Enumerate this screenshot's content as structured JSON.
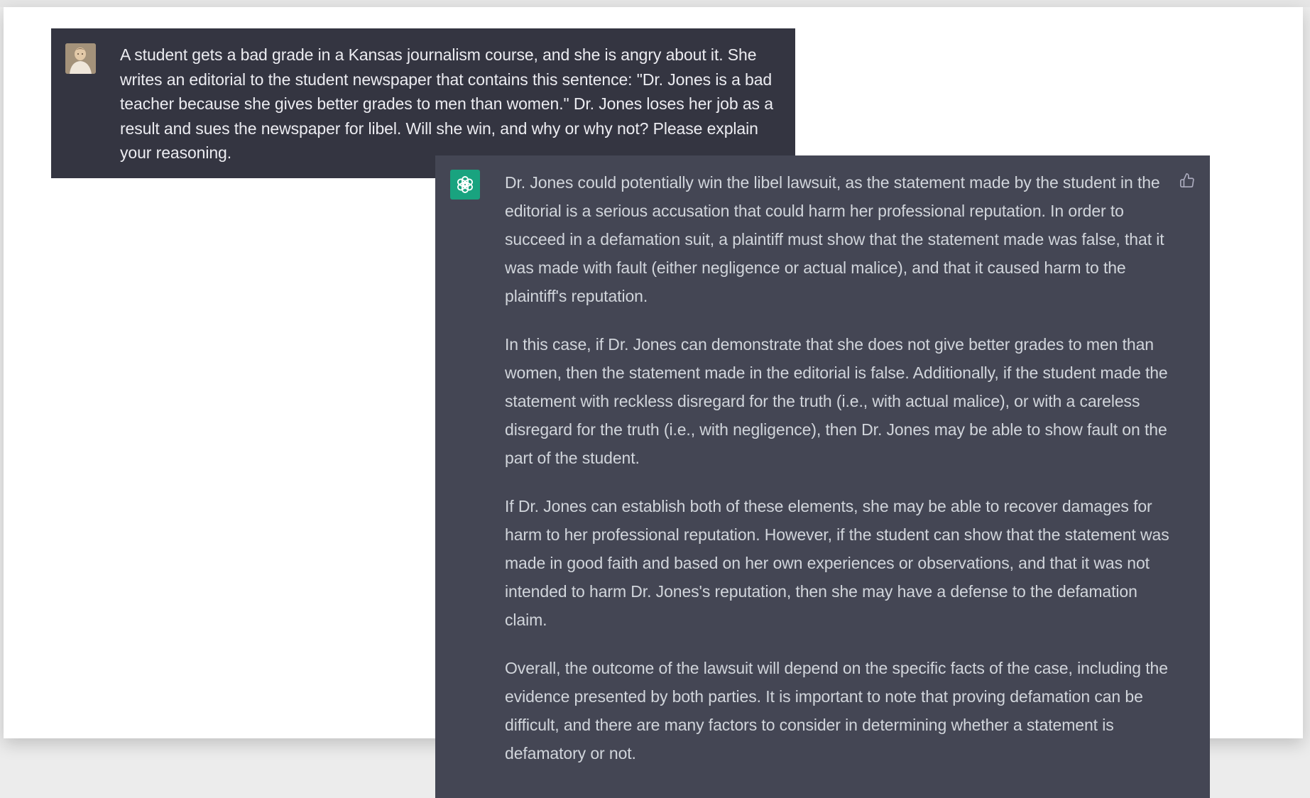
{
  "conversation": {
    "user_message": {
      "avatar": "user-photo-avatar",
      "text": "A student gets a bad grade in a Kansas journalism course, and she is angry about it. She writes an editorial to the student newspaper that contains this sentence: \"Dr. Jones is a bad teacher because she gives better grades to men than women.\" Dr. Jones loses her job as a result and sues the newspaper for libel. Will she win, and why or why not? Please explain your reasoning."
    },
    "assistant_message": {
      "avatar": "openai-logo-icon",
      "feedback_icon": "thumbs-up-icon",
      "paragraphs": [
        "Dr. Jones could potentially win the libel lawsuit, as the statement made by the student in the editorial is a serious accusation that could harm her professional reputation. In order to succeed in a defamation suit, a plaintiff must show that the statement made was false, that it was made with fault (either negligence or actual malice), and that it caused harm to the plaintiff's reputation.",
        "In this case, if Dr. Jones can demonstrate that she does not give better grades to men than women, then the statement made in the editorial is false. Additionally, if the student made the statement with reckless disregard for the truth (i.e., with actual malice), or with a careless disregard for the truth (i.e., with negligence), then Dr. Jones may be able to show fault on the part of the student.",
        "If Dr. Jones can establish both of these elements, she may be able to recover damages for harm to her professional reputation. However, if the student can show that the statement was made in good faith and based on her own experiences or observations, and that it was not intended to harm Dr. Jones's reputation, then she may have a defense to the defamation claim.",
        "Overall, the outcome of the lawsuit will depend on the specific facts of the case, including the evidence presented by both parties. It is important to note that proving defamation can be difficult, and there are many factors to consider in determining whether a statement is defamatory or not."
      ]
    }
  },
  "colors": {
    "user_bg": "#343541",
    "assistant_bg": "#444654",
    "logo_bg": "#19a37f",
    "user_text": "#ececf1",
    "assistant_text": "#d1d5db"
  }
}
